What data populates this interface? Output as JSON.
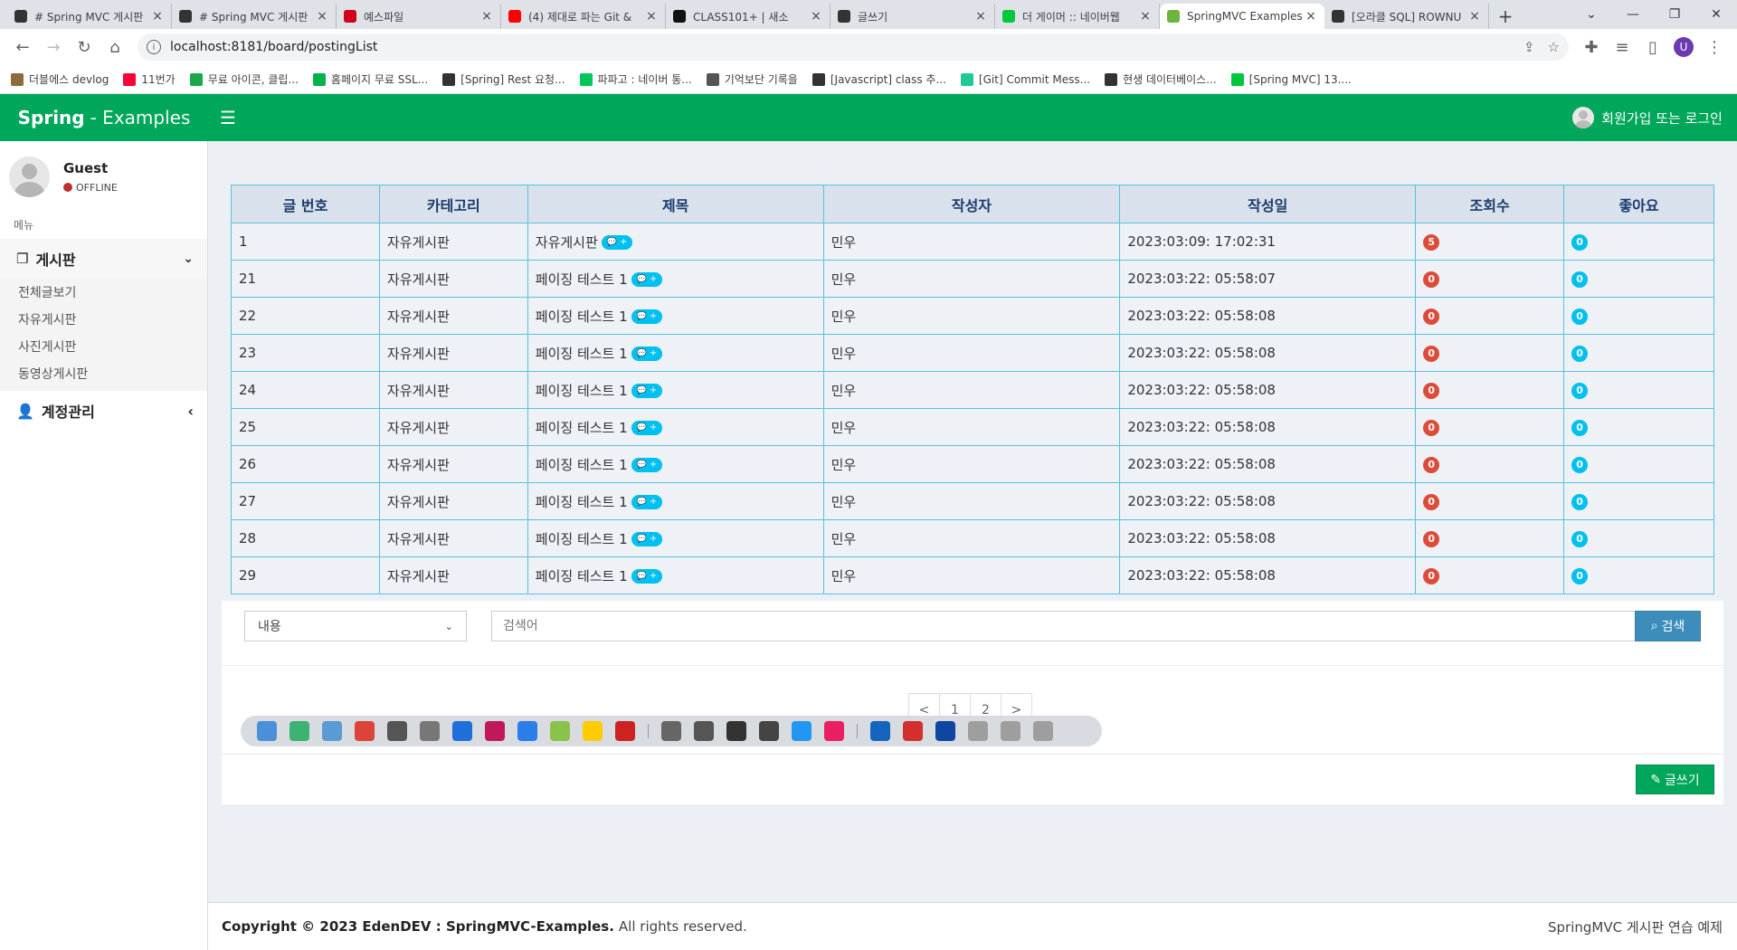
{
  "browser": {
    "tabs": [
      {
        "title": "# Spring MVC 게시판",
        "color": "#333333",
        "active": false
      },
      {
        "title": "# Spring MVC 게시판",
        "color": "#333333",
        "active": false
      },
      {
        "title": "예스파일",
        "color": "#d0021b",
        "active": false
      },
      {
        "title": "(4) 제대로 파는 Git &",
        "color": "#ff0000",
        "active": false
      },
      {
        "title": "CLASS101+ | 새소",
        "color": "#111111",
        "active": false
      },
      {
        "title": "글쓰기",
        "color": "#333333",
        "active": false
      },
      {
        "title": "더 게이머 :: 네이버웹",
        "color": "#00c73c",
        "active": false
      },
      {
        "title": "SpringMVC Examples",
        "color": "#6db33f",
        "active": true
      },
      {
        "title": "[오라클 SQL] ROWNU",
        "color": "#333333",
        "active": false
      }
    ],
    "url": "localhost:8181/board/postingList",
    "profile_initial": "U",
    "bookmarks": [
      {
        "label": "더블에스 devlog",
        "color": "#8a6d3b"
      },
      {
        "label": "11번가",
        "color": "#ff0038"
      },
      {
        "label": "무료 아이콘, 클립...",
        "color": "#1aa84b"
      },
      {
        "label": "홈페이지 무료 SSL...",
        "color": "#00b24c"
      },
      {
        "label": "[Spring] Rest 요청...",
        "color": "#333333"
      },
      {
        "label": "파파고 : 네이버 통...",
        "color": "#03c75a"
      },
      {
        "label": "기억보단 기록을",
        "color": "#555555"
      },
      {
        "label": "[Javascript] class 추...",
        "color": "#333333"
      },
      {
        "label": "[Git] Commit Mess...",
        "color": "#20c997"
      },
      {
        "label": "현생 데이터베이스...",
        "color": "#333333"
      },
      {
        "label": "[Spring MVC] 13....",
        "color": "#00c73c"
      }
    ]
  },
  "header": {
    "brand_bold": "Spring",
    "brand_light": "- Examples",
    "login_text": "회원가입 또는 로그인"
  },
  "sidebar": {
    "user_name": "Guest",
    "user_status": "OFFLINE",
    "menu_header": "메뉴",
    "board_menu": {
      "label": "게시판",
      "items": [
        "전체글보기",
        "자유게시판",
        "사진게시판",
        "동영상게시판"
      ]
    },
    "account_menu": {
      "label": "계정관리"
    }
  },
  "table": {
    "columns": [
      "글 번호",
      "카테고리",
      "제목",
      "작성자",
      "작성일",
      "조회수",
      "좋아요"
    ],
    "comment_badge": "+",
    "rows": [
      {
        "no": "1",
        "category": "자유게시판",
        "title": "자유게시판",
        "author": "민우",
        "date": "2023:03:09: 17:02:31",
        "views": "5",
        "likes": "0"
      },
      {
        "no": "21",
        "category": "자유게시판",
        "title": "페이징 테스트 1",
        "author": "민우",
        "date": "2023:03:22: 05:58:07",
        "views": "0",
        "likes": "0"
      },
      {
        "no": "22",
        "category": "자유게시판",
        "title": "페이징 테스트 1",
        "author": "민우",
        "date": "2023:03:22: 05:58:08",
        "views": "0",
        "likes": "0"
      },
      {
        "no": "23",
        "category": "자유게시판",
        "title": "페이징 테스트 1",
        "author": "민우",
        "date": "2023:03:22: 05:58:08",
        "views": "0",
        "likes": "0"
      },
      {
        "no": "24",
        "category": "자유게시판",
        "title": "페이징 테스트 1",
        "author": "민우",
        "date": "2023:03:22: 05:58:08",
        "views": "0",
        "likes": "0"
      },
      {
        "no": "25",
        "category": "자유게시판",
        "title": "페이징 테스트 1",
        "author": "민우",
        "date": "2023:03:22: 05:58:08",
        "views": "0",
        "likes": "0"
      },
      {
        "no": "26",
        "category": "자유게시판",
        "title": "페이징 테스트 1",
        "author": "민우",
        "date": "2023:03:22: 05:58:08",
        "views": "0",
        "likes": "0"
      },
      {
        "no": "27",
        "category": "자유게시판",
        "title": "페이징 테스트 1",
        "author": "민우",
        "date": "2023:03:22: 05:58:08",
        "views": "0",
        "likes": "0"
      },
      {
        "no": "28",
        "category": "자유게시판",
        "title": "페이징 테스트 1",
        "author": "민우",
        "date": "2023:03:22: 05:58:08",
        "views": "0",
        "likes": "0"
      },
      {
        "no": "29",
        "category": "자유게시판",
        "title": "페이징 테스트 1",
        "author": "민우",
        "date": "2023:03:22: 05:58:08",
        "views": "0",
        "likes": "0"
      }
    ]
  },
  "search": {
    "select_value": "내용",
    "placeholder": "검색어",
    "button_label": "검색"
  },
  "pagination": {
    "prev": "<",
    "pages": [
      "1",
      "2"
    ],
    "next": ">"
  },
  "write_button": "글쓰기",
  "taskbar_colors": [
    "#4a90d9",
    "#3cb371",
    "#5b9bd5",
    "#db4437",
    "#555555",
    "#777777",
    "#1e6fd9",
    "#c2185b",
    "#2b7de9",
    "#8bc34a",
    "#ffcc00",
    "#cc2222",
    "#666666",
    "#555555",
    "#333333",
    "#444444",
    "#2196f3",
    "#e91e63",
    "#1565c0",
    "#d32f2f",
    "#0d47a1",
    "#9e9e9e",
    "#9e9e9e",
    "#9e9e9e"
  ],
  "footer": {
    "copyright_bold": "Copyright © 2023 EdenDEV : SpringMVC-Examples.",
    "copyright_rest": "All rights reserved.",
    "right_text": "SpringMVC 게시판 연습 예제"
  }
}
